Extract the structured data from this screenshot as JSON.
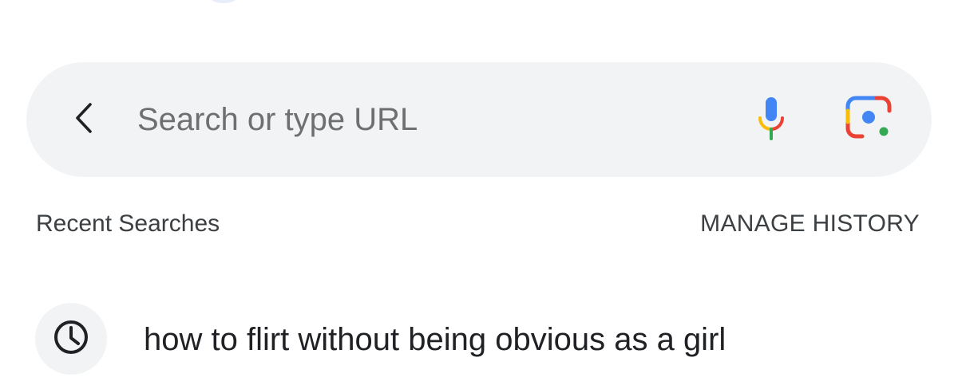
{
  "search": {
    "placeholder": "Search or type URL",
    "value": ""
  },
  "icons": {
    "back": "chevron-left-icon",
    "voice": "microphone-icon",
    "lens": "google-lens-icon",
    "history": "clock-icon"
  },
  "recent": {
    "label": "Recent Searches",
    "manage_label": "MANAGE HISTORY",
    "items": [
      {
        "text": "how to flirt without being obvious as a girl"
      }
    ]
  },
  "colors": {
    "search_bar_bg": "#f1f3f4",
    "google_blue": "#4285f4",
    "google_red": "#ea4335",
    "google_yellow": "#fbbc05",
    "google_green": "#34a853"
  }
}
